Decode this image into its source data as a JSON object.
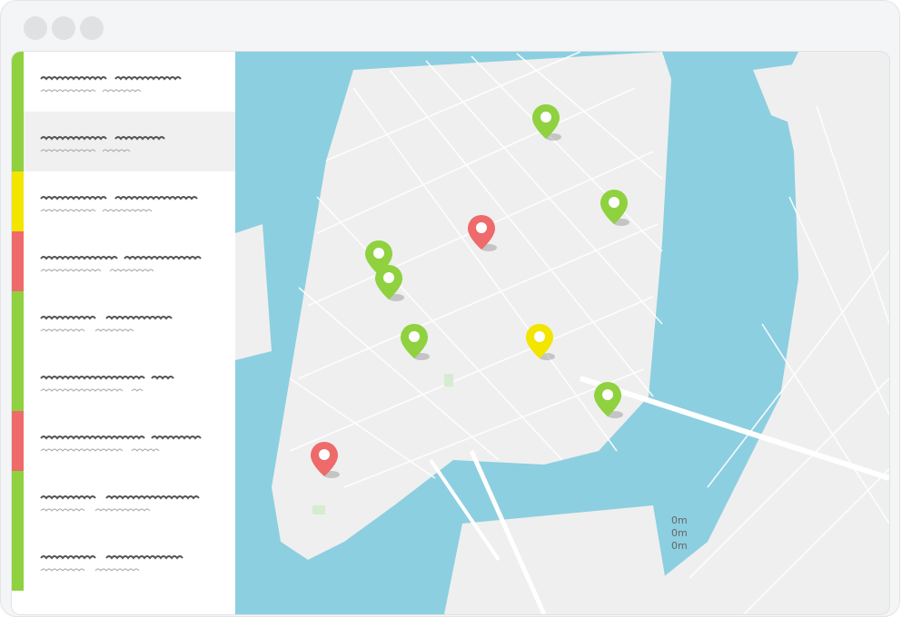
{
  "window": {
    "title": ""
  },
  "colors": {
    "green": "#8fd13f",
    "yellow": "#f2e500",
    "red": "#ef6a6a",
    "water": "#8ccfe0",
    "land": "#efefef"
  },
  "sidebar": {
    "items": [
      {
        "status": "green",
        "active": false
      },
      {
        "status": "green",
        "active": true
      },
      {
        "status": "yellow",
        "active": false
      },
      {
        "status": "red",
        "active": false
      },
      {
        "status": "green",
        "active": false
      },
      {
        "status": "green",
        "active": false
      },
      {
        "status": "red",
        "active": false
      },
      {
        "status": "green",
        "active": false
      },
      {
        "status": "green",
        "active": false
      }
    ]
  },
  "map": {
    "markers": [
      {
        "status": "green"
      },
      {
        "status": "green"
      },
      {
        "status": "red"
      },
      {
        "status": "green"
      },
      {
        "status": "green"
      },
      {
        "status": "green"
      },
      {
        "status": "yellow"
      },
      {
        "status": "green"
      },
      {
        "status": "red"
      }
    ],
    "scale_labels": [
      "0m",
      "0m",
      "0m"
    ]
  }
}
